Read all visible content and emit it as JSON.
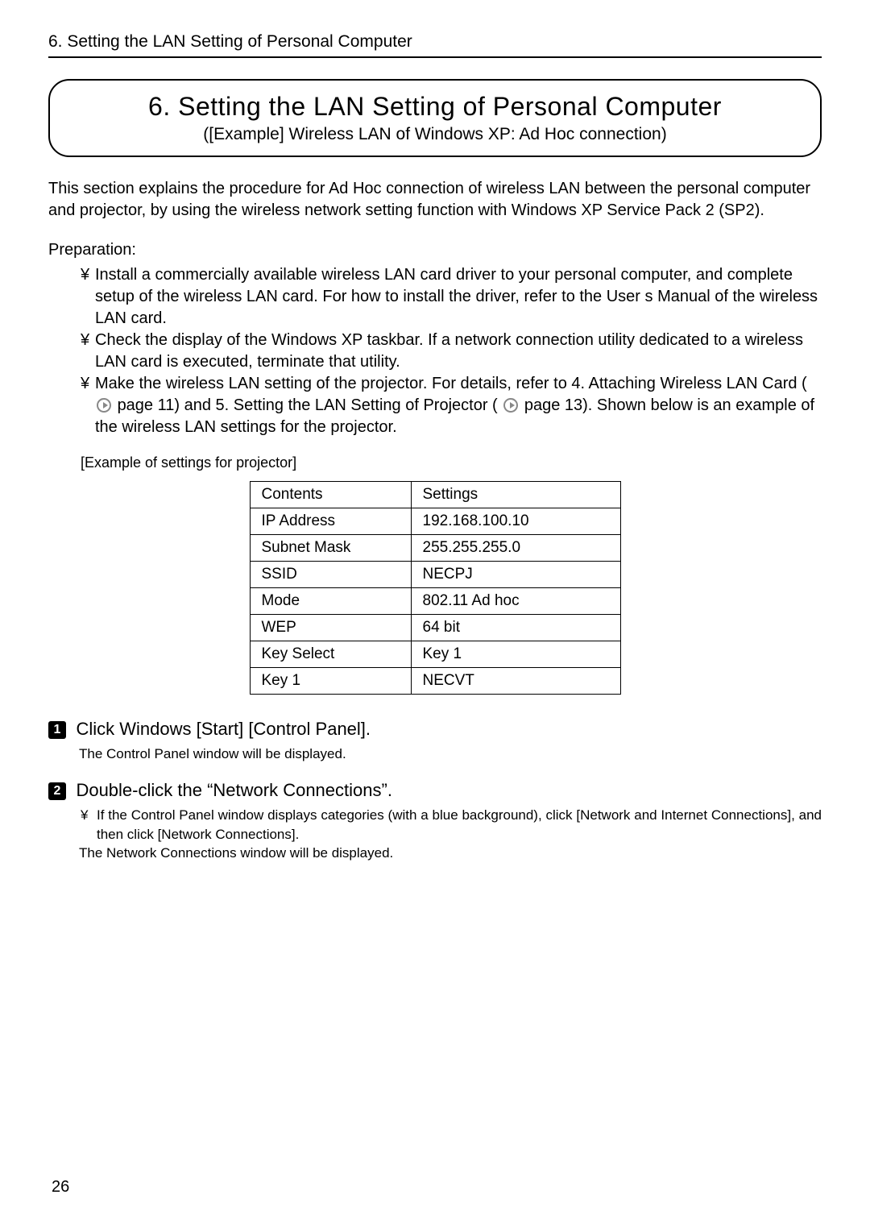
{
  "header": {
    "running_title": "6. Setting the LAN Setting of Personal Computer"
  },
  "title_box": {
    "title": "6. Setting the LAN Setting of Personal Computer",
    "subtitle": "([Example] Wireless LAN of Windows XP: Ad Hoc connection)"
  },
  "intro": "This section explains the procedure for Ad Hoc connection of wireless LAN between the personal computer and projector, by using the wireless network setting function with Windows XP Service Pack 2 (SP2).",
  "preparation": {
    "label": "Preparation:",
    "items": [
      "Install a commercially available wireless LAN card driver to your personal computer, and complete setup of the wireless LAN card.  For how to install the driver, refer to the User s Manual of the wireless LAN card.",
      "Check the display of the Windows XP taskbar.  If a network connection utility dedicated to a wireless LAN card is executed, terminate that utility."
    ],
    "item3_pre": "Make the wireless LAN setting of the projector. For details, refer to  4. Attaching Wireless LAN Card  (",
    "item3_ref1": " page 11) and  5. Setting the LAN Setting of Projector  (",
    "item3_ref2": " page 13). Shown below is an example of the wireless LAN settings for the projector."
  },
  "example_label": "[Example of settings for projector]",
  "settings_table": {
    "rows": [
      {
        "k": "Contents",
        "v": "Settings"
      },
      {
        "k": "IP Address",
        "v": "192.168.100.10"
      },
      {
        "k": "Subnet Mask",
        "v": "255.255.255.0"
      },
      {
        "k": "SSID",
        "v": "NECPJ"
      },
      {
        "k": "Mode",
        "v": "802.11 Ad hoc"
      },
      {
        "k": "WEP",
        "v": "64 bit"
      },
      {
        "k": "Key Select",
        "v": "Key 1"
      },
      {
        "k": "Key 1",
        "v": "NECVT"
      }
    ]
  },
  "steps": [
    {
      "num": "1",
      "title": "Click Windows [Start]     [Control Panel].",
      "notes": [
        {
          "bullet": false,
          "text": "The  Control Panel  window will be displayed."
        }
      ]
    },
    {
      "num": "2",
      "title": "Double-click the “Network Connections”.",
      "notes": [
        {
          "bullet": true,
          "text": "If the  Control Panel  window displays categories (with a blue background), click [Network and Internet Connections], and then click [Network Connections]."
        },
        {
          "bullet": false,
          "text": "The  Network Connections  window will be displayed."
        }
      ]
    }
  ],
  "page_number": "26"
}
